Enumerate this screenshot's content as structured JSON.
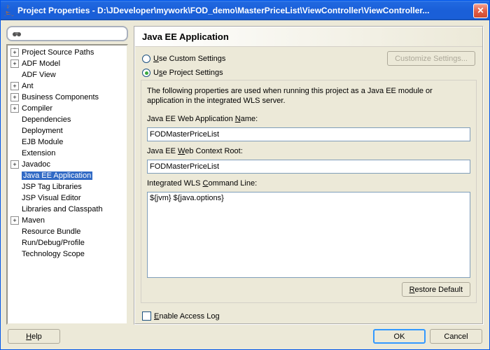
{
  "window": {
    "title": "Project Properties - D:\\JDeveloper\\mywork\\FOD_demo\\MasterPriceList\\ViewController\\ViewController..."
  },
  "tree": {
    "items": [
      {
        "label": "Project Source Paths",
        "expander": "+"
      },
      {
        "label": "ADF Model",
        "expander": "+"
      },
      {
        "label": "ADF View",
        "expander": ""
      },
      {
        "label": "Ant",
        "expander": "+"
      },
      {
        "label": "Business Components",
        "expander": "+"
      },
      {
        "label": "Compiler",
        "expander": "+"
      },
      {
        "label": "Dependencies",
        "expander": ""
      },
      {
        "label": "Deployment",
        "expander": ""
      },
      {
        "label": "EJB Module",
        "expander": ""
      },
      {
        "label": "Extension",
        "expander": ""
      },
      {
        "label": "Javadoc",
        "expander": "+"
      },
      {
        "label": "Java EE Application",
        "expander": "",
        "selected": true
      },
      {
        "label": "JSP Tag Libraries",
        "expander": ""
      },
      {
        "label": "JSP Visual Editor",
        "expander": ""
      },
      {
        "label": "Libraries and Classpath",
        "expander": ""
      },
      {
        "label": "Maven",
        "expander": "+"
      },
      {
        "label": "Resource Bundle",
        "expander": ""
      },
      {
        "label": "Run/Debug/Profile",
        "expander": ""
      },
      {
        "label": "Technology Scope",
        "expander": ""
      }
    ]
  },
  "panel": {
    "title": "Java EE Application",
    "use_custom": "Use Custom Settings",
    "use_project": "Use Project Settings",
    "customize_btn": "Customize Settings...",
    "description": "The following properties are used when running this project as a Java EE module or application in the integrated WLS server.",
    "app_name_label_pre": "Java EE Web Application ",
    "app_name_label_u": "N",
    "app_name_label_post": "ame:",
    "app_name_value": "FODMasterPriceList",
    "ctx_root_label_pre": "Java EE ",
    "ctx_root_label_u": "W",
    "ctx_root_label_post": "eb Context Root:",
    "ctx_root_value": "FODMasterPriceList",
    "cmd_line_label_pre": "Integrated WLS ",
    "cmd_line_label_u": "C",
    "cmd_line_label_post": "ommand Line:",
    "cmd_line_value": "${jvm} ${java.options}",
    "restore_btn_u": "R",
    "restore_btn_post": "estore Default",
    "enable_log_u": "E",
    "enable_log_post": "nable Access Log"
  },
  "footer": {
    "help": "Help",
    "ok": "OK",
    "cancel": "Cancel"
  }
}
